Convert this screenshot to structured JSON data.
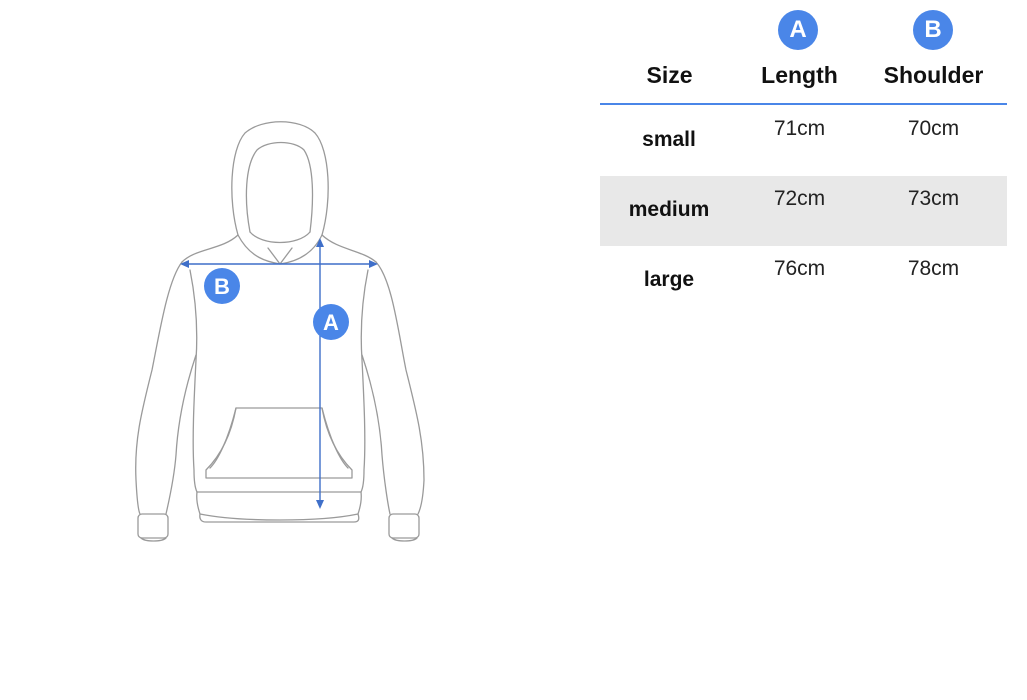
{
  "colors": {
    "accent": "#4a86e8",
    "row_alt": "#e8e8e8",
    "outline": "#9a9a9a"
  },
  "illustration": {
    "garment": "hoodie-outline",
    "markers": {
      "length": "A",
      "shoulder": "B"
    }
  },
  "table": {
    "headers": {
      "size": "Size",
      "length": "Length",
      "shoulder": "Shoulder",
      "length_badge": "A",
      "shoulder_badge": "B"
    },
    "rows": [
      {
        "size": "small",
        "length": "71cm",
        "shoulder": "70cm"
      },
      {
        "size": "medium",
        "length": "72cm",
        "shoulder": "73cm"
      },
      {
        "size": "large",
        "length": "76cm",
        "shoulder": "78cm"
      }
    ]
  }
}
